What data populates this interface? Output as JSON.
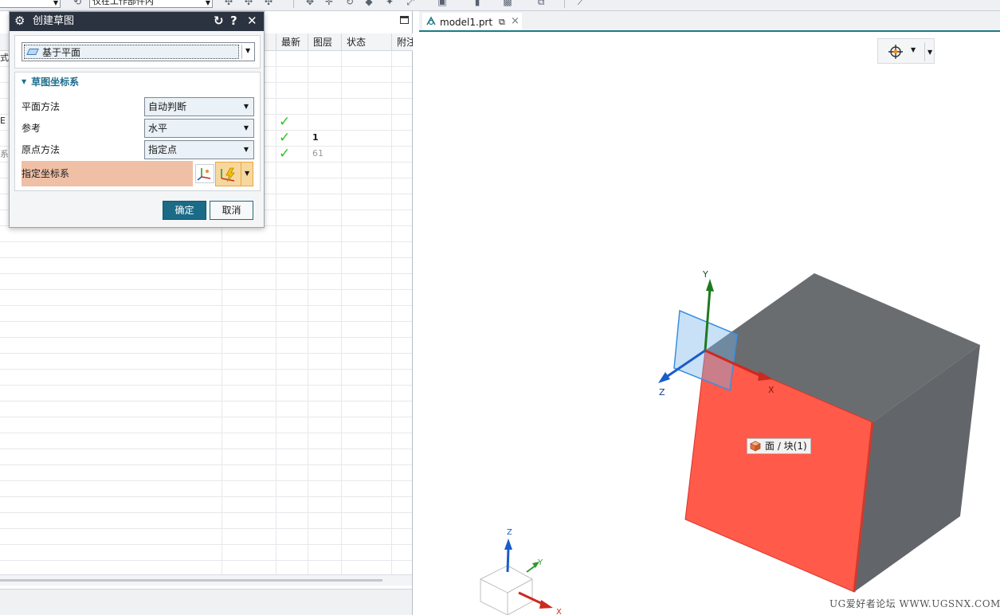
{
  "toolbar": {
    "filter_value": "仅在工作部件内"
  },
  "navigator": {
    "columns": [
      "最新",
      "图层",
      "状态",
      "附注"
    ],
    "edge_labels": [
      "式",
      "E",
      "系"
    ],
    "layer_values": [
      "1",
      "61"
    ]
  },
  "dialog": {
    "title": "创建草图",
    "type_value": "基于平面",
    "section_title": "草图坐标系",
    "plane_method_label": "平面方法",
    "plane_method_value": "自动判断",
    "reference_label": "参考",
    "reference_value": "水平",
    "origin_method_label": "原点方法",
    "origin_method_value": "指定点",
    "specify_csys_label": "指定坐标系",
    "ok_label": "确定",
    "cancel_label": "取消",
    "reset_glyph": "↻",
    "help_glyph": "?",
    "close_glyph": "✕"
  },
  "graphics": {
    "tab_name": "model1.prt",
    "tab_close": "×",
    "tooltip": "面 / 块(1)",
    "axis_labels": {
      "x": "X",
      "y": "Y",
      "z": "Z"
    },
    "triad_labels": {
      "x": "X",
      "y": "Y",
      "z": "Z"
    },
    "watermark": "UG爱好者论坛 WWW.UGSNX.COM"
  },
  "colors": {
    "accent": "#1b6b86",
    "selected_face": "#ff5a4a",
    "block_gray": "#6a6d70",
    "specify_highlight": "#f0c0a6",
    "check_green": "#2ec02e"
  }
}
